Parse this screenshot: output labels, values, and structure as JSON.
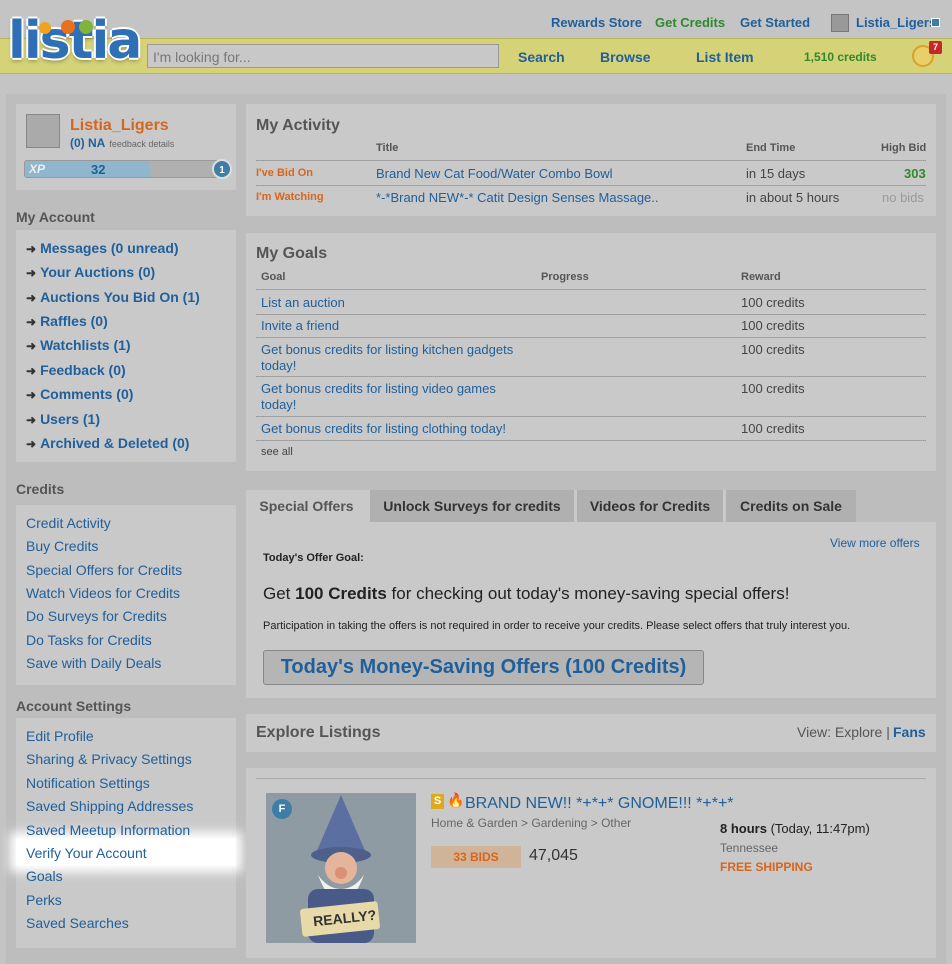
{
  "header": {
    "logo": "listia",
    "links": [
      "Rewards Store",
      "Get Credits",
      "Get Started"
    ],
    "username": "Listia_Ligers",
    "search_placeholder": "I'm looking for...",
    "nav": [
      "Search",
      "Browse",
      "List Item"
    ],
    "credits": "1,510 credits",
    "notifications": "7"
  },
  "profile": {
    "name": "Listia_Ligers",
    "feedback": "(0) NA",
    "feedback_link": "feedback details",
    "xp_label": "XP",
    "xp_value": "32",
    "xp_progress": 0.62,
    "level": "1"
  },
  "my_account": {
    "heading": "My Account",
    "items": [
      "Messages (0 unread)",
      "Your Auctions (0)",
      "Auctions You Bid On (1)",
      "Raffles (0)",
      "Watchlists (1)",
      "Feedback (0)",
      "Comments (0)",
      "Users (1)",
      "Archived & Deleted (0)"
    ]
  },
  "credits_menu": {
    "heading": "Credits",
    "items": [
      "Credit Activity",
      "Buy Credits",
      "Special Offers for Credits",
      "Watch Videos for Credits",
      "Do Surveys for Credits",
      "Do Tasks for Credits",
      "Save with Daily Deals"
    ]
  },
  "account_settings": {
    "heading": "Account Settings",
    "items": [
      "Edit Profile",
      "Sharing & Privacy Settings",
      "Notification Settings",
      "Saved Shipping Addresses",
      "Saved Meetup Information",
      "Verify Your Account",
      "Goals",
      "Perks",
      "Saved Searches"
    ]
  },
  "activity": {
    "title": "My Activity",
    "columns": [
      "Title",
      "End Time",
      "High Bid"
    ],
    "rows": [
      {
        "type": "I've Bid On",
        "title": "Brand New Cat Food/Water Combo Bowl",
        "end": "in 15 days",
        "bid": "303"
      },
      {
        "type": "I'm Watching",
        "title": "*-*Brand NEW*-* Catit Design Senses Massage..",
        "end": "in about 5 hours",
        "bid": "no bids"
      }
    ]
  },
  "goals": {
    "title": "My Goals",
    "columns": [
      "Goal",
      "Progress",
      "Reward"
    ],
    "rows": [
      {
        "goal": "List an auction",
        "goal2": "",
        "reward": "100 credits"
      },
      {
        "goal": "Invite a friend",
        "goal2": "",
        "reward": "100 credits"
      },
      {
        "goal": "Get bonus credits for listing kitchen gadgets",
        "goal2": "today!",
        "reward": "100 credits"
      },
      {
        "goal": "Get bonus credits for listing video games",
        "goal2": "today!",
        "reward": "100 credits"
      },
      {
        "goal": "Get bonus credits for listing clothing today!",
        "goal2": "",
        "reward": "100 credits"
      }
    ],
    "see_all": "see all"
  },
  "offers": {
    "tabs": [
      "Special Offers",
      "Unlock Surveys for credits",
      "Videos for Credits",
      "Credits on Sale"
    ],
    "goal_label": "Today's Offer Goal:",
    "view_more": "View more offers",
    "headline_pre": "Get ",
    "headline_bold": "100 Credits",
    "headline_post": " for checking out today's money-saving special offers!",
    "note": "Participation in taking the offers is not required in order to receive your credits. Please select offers that truly interest you.",
    "button": "Today's Money-Saving Offers (100 Credits)"
  },
  "explore": {
    "title": "Explore Listings",
    "view_label": "View: Explore |",
    "fans": "Fans"
  },
  "listing": {
    "title": "BRAND NEW!! *+*+* GNOME!!! *+*+*",
    "category": "Home & Garden > Gardening > Other",
    "bids": "33 BIDS",
    "price": "47,045",
    "time_bold": "8 hours",
    "time_rest": " (Today, 11:47pm)",
    "location": "Tennessee",
    "shipping": "FREE SHIPPING",
    "badge": "F",
    "sign": "REALLY?"
  }
}
